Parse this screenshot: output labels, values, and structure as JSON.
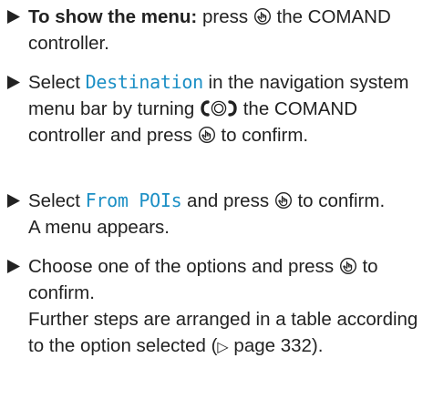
{
  "steps": [
    {
      "lead": "To show the menu:",
      "part1": " press ",
      "part2": " the COMAND controller."
    },
    {
      "part1": "Select ",
      "ui_term": "Destination",
      "part2": " in the navigation system menu bar by turning ",
      "part3": " the COMAND controller and press ",
      "part4": " to confirm."
    },
    {
      "part1": "Select ",
      "ui_term": "From POIs",
      "part2": " and press ",
      "part3": " to confirm.",
      "result": "A menu appears."
    },
    {
      "part1": "Choose one of the options and press ",
      "part2": " to confirm.",
      "result_part1": "Further steps are arranged in a table according to the option selected (",
      "ref_mark": "▷",
      "result_part2": " page 332)."
    }
  ],
  "icons": {
    "step_marker": "triangle-bullet-icon",
    "press": "press-controller-icon",
    "turn": "turn-controller-icon"
  },
  "colors": {
    "text": "#222222",
    "ui_term": "#1b8fc5"
  }
}
